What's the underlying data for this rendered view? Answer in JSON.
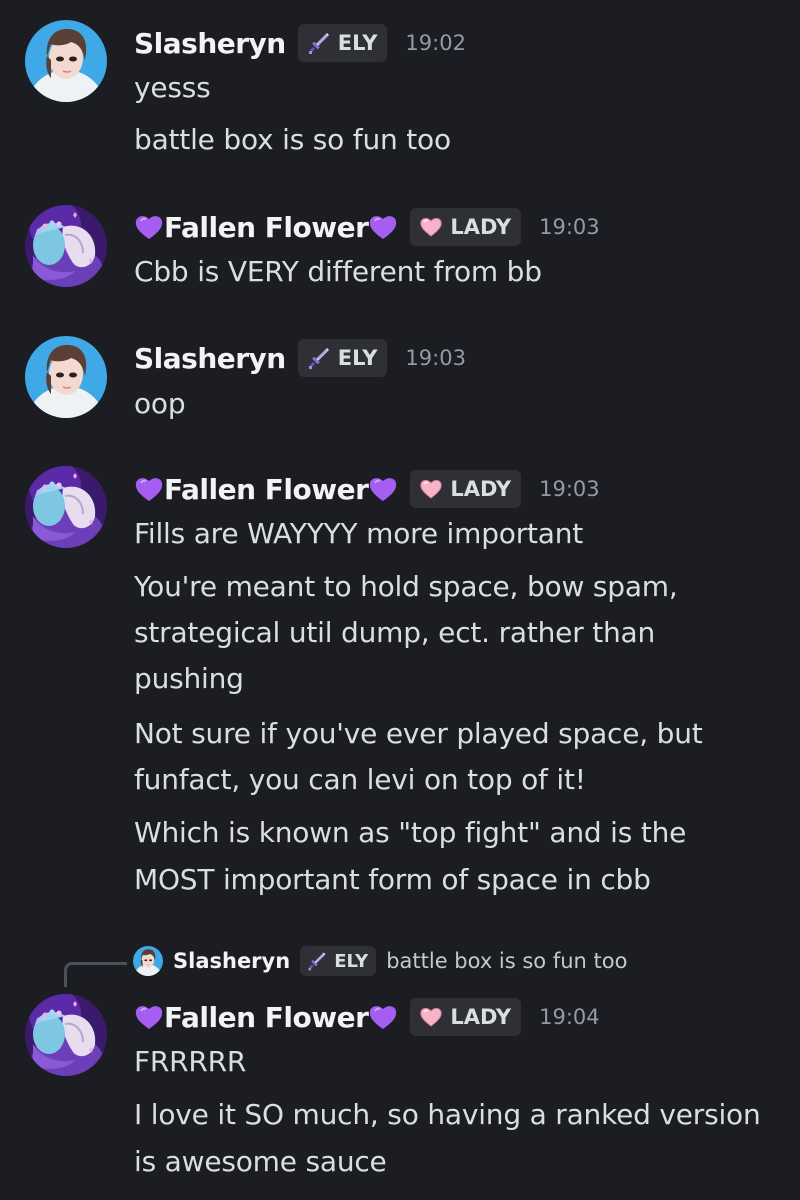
{
  "messages": [
    {
      "author": "Slasheryn",
      "tag": "ELY",
      "tag_icon": "sword-icon",
      "time": "19:02",
      "lines": [
        "yesss",
        "battle box is so fun too"
      ]
    },
    {
      "author_prefix": "💜",
      "author": "Fallen Flower",
      "author_suffix": "💜",
      "tag": "LADY",
      "tag_icon": "pink-heart-icon",
      "time": "19:03",
      "lines": [
        "Cbb is VERY different from bb"
      ]
    },
    {
      "author": "Slasheryn",
      "tag": "ELY",
      "tag_icon": "sword-icon",
      "time": "19:03",
      "lines": [
        "oop"
      ]
    },
    {
      "author_prefix": "💜",
      "author": "Fallen Flower",
      "author_suffix": "💜",
      "tag": "LADY",
      "tag_icon": "pink-heart-icon",
      "time": "19:03",
      "lines": [
        "Fills are WAYYYY more important",
        "You're meant to hold space, bow spam,",
        "strategical util dump, ect. rather than",
        "pushing",
        "Not sure if you've ever played space, but",
        "funfact, you can levi on top of it!",
        "Which is known as \"top fight\" and is the",
        "MOST important form of space in cbb"
      ]
    },
    {
      "reply_to": {
        "author": "Slasheryn",
        "tag": "ELY",
        "text": "battle box is so fun too"
      },
      "author_prefix": "💜",
      "author": "Fallen Flower",
      "author_suffix": "💜",
      "tag": "LADY",
      "tag_icon": "pink-heart-icon",
      "time": "19:04",
      "lines": [
        "FRRRRR",
        "I love it SO much, so having a ranked version",
        "is awesome sauce"
      ]
    }
  ],
  "colors": {
    "background": "#1c1d22",
    "username": "#f2f3f5",
    "text": "#dbdee1",
    "timestamp": "#949ba4",
    "tag_bg": "#2e3036",
    "purple_heart": "#a55df2",
    "pink_heart": "#f7b4c8"
  }
}
